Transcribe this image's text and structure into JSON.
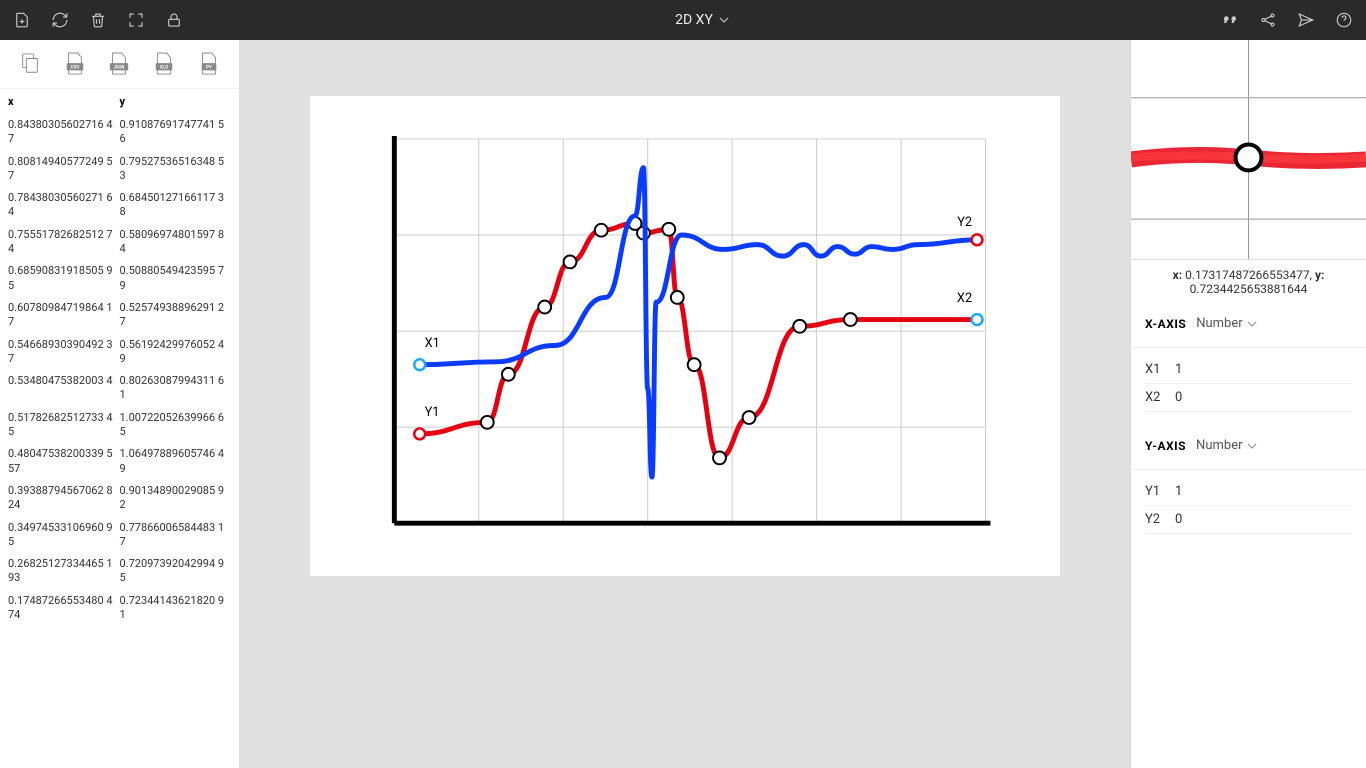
{
  "header": {
    "title": "2D XY"
  },
  "data_columns": {
    "x_header": "x",
    "y_header": "y"
  },
  "data_rows": [
    {
      "x": "0.84380305602716 47",
      "y": "0.91087691747741 56"
    },
    {
      "x": "0.80814940577249 57",
      "y": "0.79527536516348 53"
    },
    {
      "x": "0.78438030560271 64",
      "y": "0.68450127166117 38"
    },
    {
      "x": "0.75551782682512 74",
      "y": "0.58096974801597 84"
    },
    {
      "x": "0.68590831918505 95",
      "y": "0.50880549423595 79"
    },
    {
      "x": "0.60780984719864 17",
      "y": "0.52574938896291 27"
    },
    {
      "x": "0.54668930390492 37",
      "y": "0.56192429976052 49"
    },
    {
      "x": "0.53480475382003 4",
      "y": "0.80263087994311 61"
    },
    {
      "x": "0.51782682512733 45",
      "y": "1.00722052639966 65"
    },
    {
      "x": "0.48047538200339 557",
      "y": "1.06497889605746 49"
    },
    {
      "x": "0.39388794567062 824",
      "y": "0.90134890029085 92"
    },
    {
      "x": "0.34974533106960 95",
      "y": "0.77866006584483 17"
    },
    {
      "x": "0.26825127334465 193",
      "y": "0.72097392042994 95"
    },
    {
      "x": "0.17487266553480 474",
      "y": "0.72344143621820 91"
    }
  ],
  "chart_labels": {
    "X1": "X1",
    "Y1": "Y1",
    "X2": "X2",
    "Y2": "Y2"
  },
  "readout": {
    "x_label": "x:",
    "x_val": "0.17317487266553477,",
    "y_label": "y:",
    "y_val": "0.7234425653881644"
  },
  "xaxis": {
    "title": "X-AXIS",
    "type": "Number",
    "rows": [
      {
        "l": "X1",
        "v": "1"
      },
      {
        "l": "X2",
        "v": "0"
      }
    ]
  },
  "yaxis": {
    "title": "Y-AXIS",
    "type": "Number",
    "rows": [
      {
        "l": "Y1",
        "v": "1"
      },
      {
        "l": "Y2",
        "v": "0"
      }
    ]
  },
  "chart_data": {
    "type": "line",
    "xlim": [
      0,
      7
    ],
    "ylim": [
      0,
      4
    ],
    "series": [
      {
        "name": "red-curve",
        "color": "#e60012",
        "points_with_markers": true,
        "x": [
          0.3,
          1.1,
          1.35,
          1.78,
          2.08,
          2.45,
          2.85,
          2.95,
          3.25,
          3.35,
          3.55,
          3.85,
          4.2,
          4.8,
          5.4,
          6.9
        ],
        "y": [
          0.93,
          1.05,
          1.55,
          2.25,
          2.72,
          3.05,
          3.12,
          3.02,
          3.06,
          2.35,
          1.65,
          0.68,
          1.1,
          2.05,
          2.12,
          2.12
        ]
      },
      {
        "name": "blue-curve",
        "color": "#0a3cff",
        "points_with_markers": false,
        "x": [
          0.3,
          1.2,
          1.9,
          2.5,
          2.85,
          2.95,
          3.0,
          3.05,
          3.1,
          3.4,
          3.9,
          4.3,
          4.6,
          4.85,
          5.05,
          5.25,
          5.45,
          5.65,
          5.9,
          6.2,
          6.9
        ],
        "y": [
          1.65,
          1.68,
          1.85,
          2.35,
          3.2,
          3.7,
          1.4,
          0.48,
          2.3,
          3.0,
          2.85,
          2.9,
          2.78,
          2.9,
          2.78,
          2.88,
          2.8,
          2.88,
          2.85,
          2.9,
          2.95
        ]
      }
    ],
    "endpoints": [
      {
        "name": "X1",
        "x": 0.3,
        "y": 1.65,
        "color": "#1ea7ff"
      },
      {
        "name": "Y1",
        "x": 0.3,
        "y": 0.93,
        "color": "#e60012"
      },
      {
        "name": "X2",
        "x": 6.9,
        "y": 2.12,
        "color": "#1ea7ff"
      },
      {
        "name": "Y2",
        "x": 6.9,
        "y": 2.95,
        "color": "#e60012"
      }
    ]
  }
}
